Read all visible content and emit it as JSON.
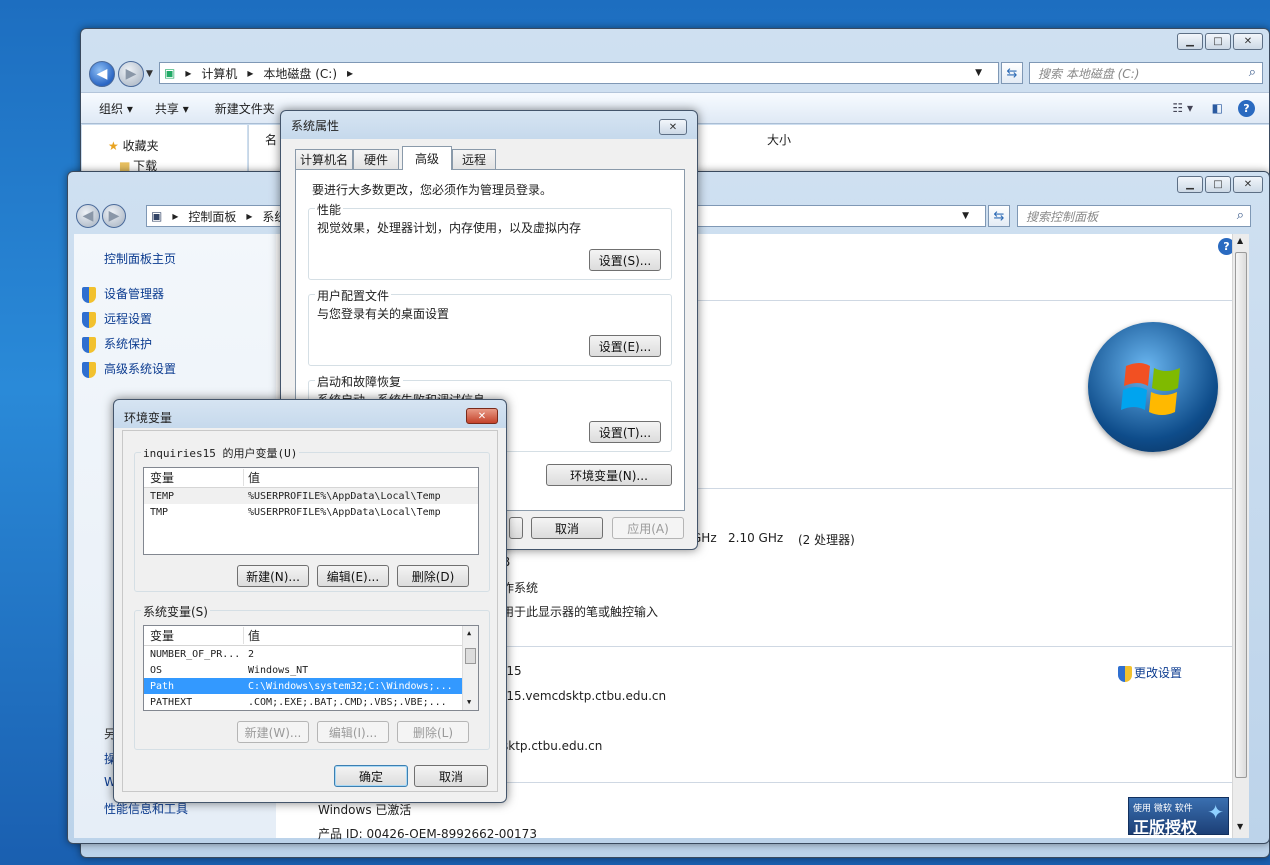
{
  "explorer": {
    "breadcrumb": [
      "计算机",
      "本地磁盘 (C:)"
    ],
    "search_placeholder": "搜索 本地磁盘 (C:)",
    "toolbar": {
      "organize": "组织",
      "share": "共享",
      "new_folder": "新建文件夹"
    },
    "nav_items": [
      "收藏夹",
      "下载"
    ],
    "col_name": "名",
    "col_size": "大小"
  },
  "control_panel": {
    "breadcrumb": [
      "控制面板",
      "系统"
    ],
    "search_placeholder": "搜索控制面板",
    "home_link": "控制面板主页",
    "side_links": [
      "设备管理器",
      "远程设置",
      "系统保护",
      "高级系统设置"
    ],
    "see_also_partial": [
      "另",
      "操",
      "W"
    ],
    "perf_link": "性能信息和工具",
    "cpu_tail": "GHz",
    "cpu_speed": "2.10 GHz",
    "cpu_count": "(2 处理器)",
    "ram_tail": "B",
    "os_tail": "作系统",
    "pen_tail": "用于此显示器的笔或触控输入",
    "computer_name_tail": "-15",
    "full_name_tail": "-15.vemcdsktp.ctbu.edu.cn",
    "domain_tail": "sktp.ctbu.edu.cn",
    "change_settings": "更改设置",
    "activation": "Windows 已激活",
    "product_id": "产品 ID: 00426-OEM-8992662-00173",
    "genuine_small": "使用 微软 软件",
    "genuine_big": "正版授权"
  },
  "sysprops": {
    "title": "系统属性",
    "tabs": [
      "计算机名",
      "硬件",
      "高级",
      "远程"
    ],
    "admin_note": "要进行大多数更改，您必须作为管理员登录。",
    "perf_group": "性能",
    "perf_desc": "视觉效果，处理器计划，内存使用，以及虚拟内存",
    "profile_group": "用户配置文件",
    "profile_desc": "与您登录有关的桌面设置",
    "startup_group": "启动和故障恢复",
    "startup_desc": "系统启动、系统失败和调试信息",
    "settings_s": "设置(S)...",
    "settings_e": "设置(E)...",
    "settings_t": "设置(T)...",
    "env_button": "环境变量(N)...",
    "cancel": "取消",
    "apply": "应用(A)"
  },
  "envvars": {
    "title": "环境变量",
    "user_group": "inquiries15 的用户变量(U)",
    "col_var": "变量",
    "col_val": "值",
    "user_vars": [
      {
        "name": "TEMP",
        "value": "%USERPROFILE%\\AppData\\Local\\Temp"
      },
      {
        "name": "TMP",
        "value": "%USERPROFILE%\\AppData\\Local\\Temp"
      }
    ],
    "user_new": "新建(N)...",
    "user_edit": "编辑(E)...",
    "user_delete": "删除(D)",
    "sys_group": "系统变量(S)",
    "sys_vars": [
      {
        "name": "NUMBER_OF_PR...",
        "value": "2"
      },
      {
        "name": "OS",
        "value": "Windows_NT"
      },
      {
        "name": "Path",
        "value": "C:\\Windows\\system32;C:\\Windows;..."
      },
      {
        "name": "PATHEXT",
        "value": ".COM;.EXE;.BAT;.CMD;.VBS;.VBE;..."
      }
    ],
    "sys_new": "新建(W)...",
    "sys_edit": "编辑(I)...",
    "sys_delete": "删除(L)",
    "ok": "确定",
    "cancel": "取消"
  }
}
